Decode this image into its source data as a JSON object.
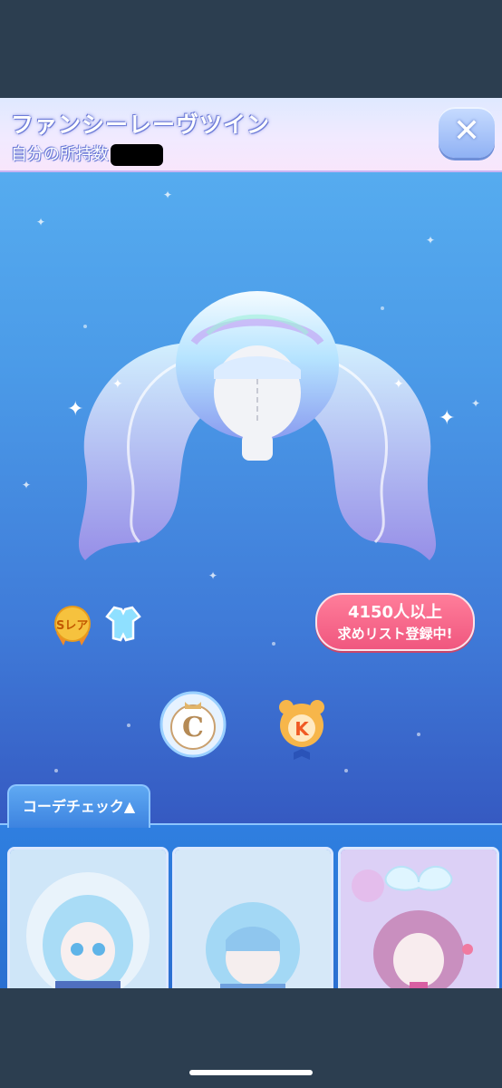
{
  "item": {
    "title": "ファンシーレーヴツイン",
    "owned_label": "自分の所持数"
  },
  "header": {
    "close_icon": "close-icon",
    "close_glyph": "✕"
  },
  "item_info": {
    "rarity_label": "Sレア",
    "category_icon": "clothing-icon"
  },
  "wishlist": {
    "count_text": "4150人以上",
    "status_text": "求めリスト登録中!"
  },
  "shop_icons": [
    {
      "name": "c-icon",
      "letter": "C"
    },
    {
      "name": "k-icon",
      "letter": "K"
    }
  ],
  "coordinate": {
    "tab_label": "コーデチェック▲",
    "thumbnails": [
      "coord-thumbnail-1",
      "coord-thumbnail-2",
      "coord-thumbnail-3"
    ]
  },
  "colors": {
    "badge_pink": "#f0577f",
    "accent_blue": "#3d83e0",
    "title_outline": "#6e7cd8"
  }
}
